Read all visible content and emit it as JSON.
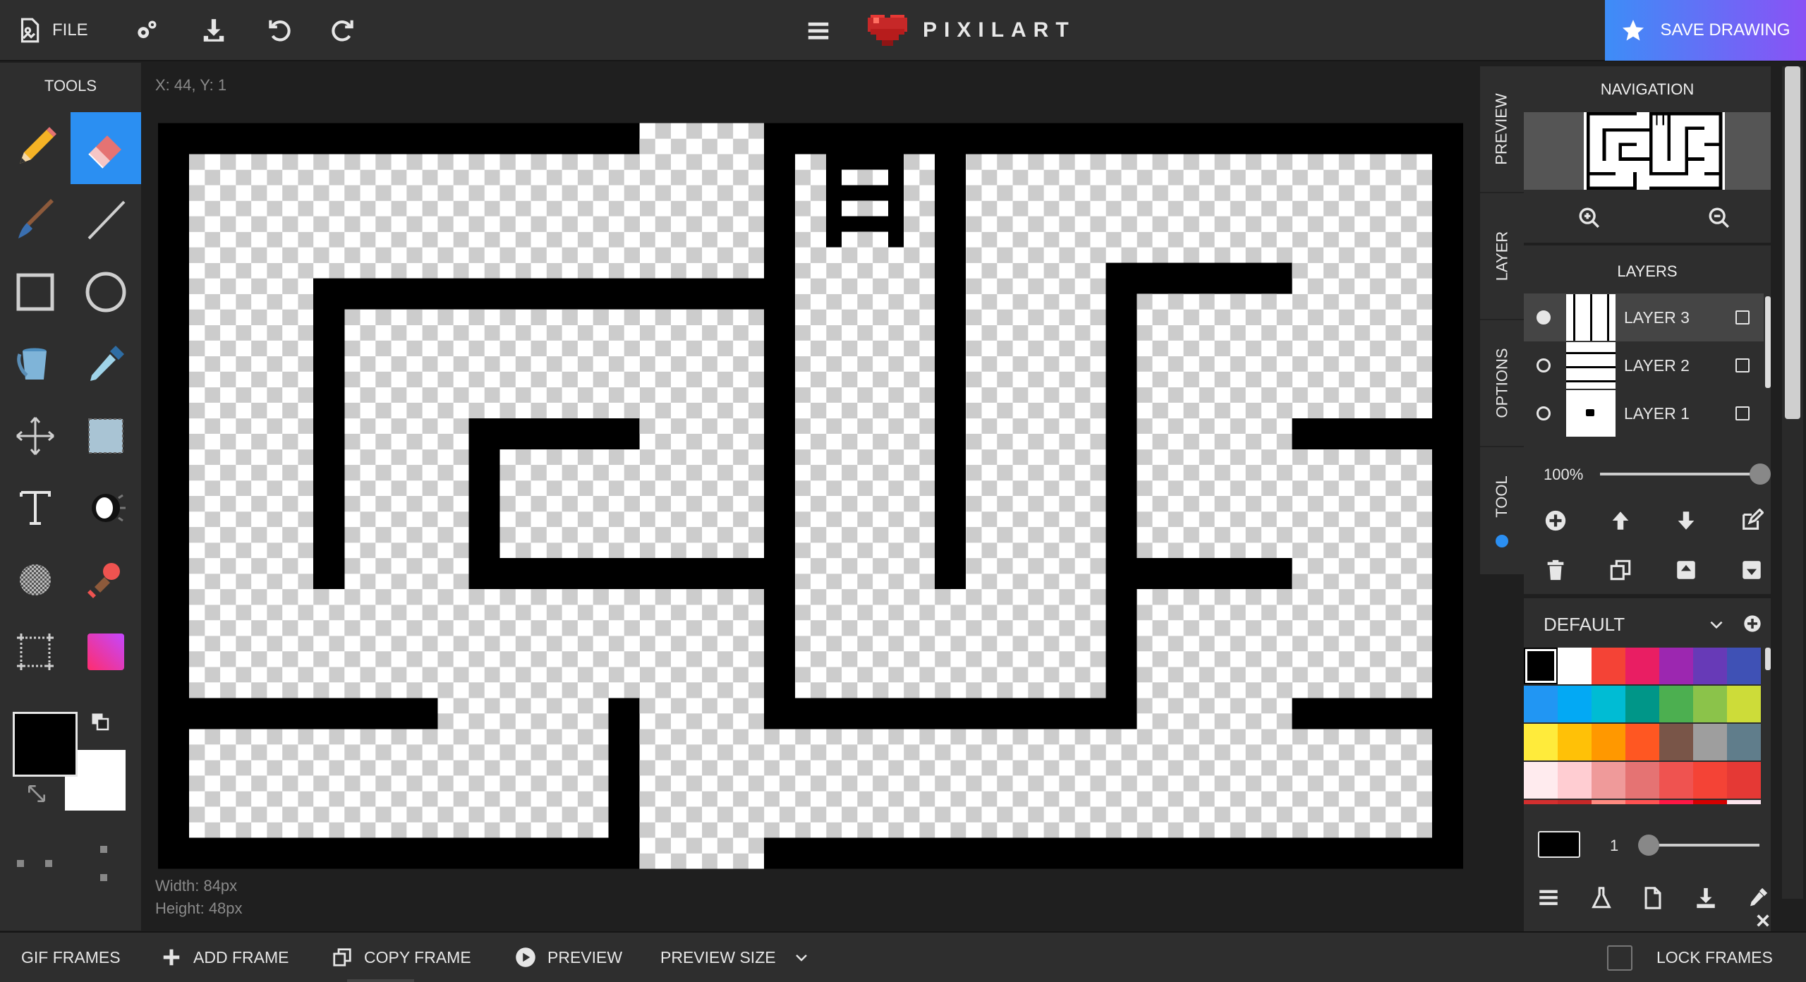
{
  "topbar": {
    "file_label": "FILE",
    "logo_text": "PIXILART",
    "save_label": "SAVE DRAWING"
  },
  "tools": {
    "title": "TOOLS",
    "items": [
      {
        "name": "pencil-tool"
      },
      {
        "name": "eraser-tool",
        "active": true
      },
      {
        "name": "brush-tool"
      },
      {
        "name": "line-tool"
      },
      {
        "name": "rectangle-tool"
      },
      {
        "name": "circle-tool"
      },
      {
        "name": "bucket-fill-tool"
      },
      {
        "name": "eyedropper-tool"
      },
      {
        "name": "move-tool"
      },
      {
        "name": "selection-tool"
      },
      {
        "name": "text-tool"
      },
      {
        "name": "lighten-tool"
      },
      {
        "name": "dither-tool"
      },
      {
        "name": "stamp-tool"
      },
      {
        "name": "crop-tool"
      },
      {
        "name": "gradient-tool"
      }
    ],
    "primary_color": "#000000",
    "secondary_color": "#ffffff"
  },
  "canvas": {
    "coords": "X: 44, Y: 1",
    "width_label": "Width: 84px",
    "height_label": "Height: 48px"
  },
  "side_tabs": [
    "PREVIEW",
    "LAYER",
    "OPTIONS",
    "TOOL"
  ],
  "navigation": {
    "title": "NAVIGATION"
  },
  "layers": {
    "title": "LAYERS",
    "items": [
      {
        "name": "LAYER 3",
        "selected": true
      },
      {
        "name": "LAYER 2",
        "selected": false
      },
      {
        "name": "LAYER 1",
        "selected": false
      }
    ],
    "opacity": "100%"
  },
  "palette": {
    "name": "DEFAULT",
    "brush_size": "1",
    "colors": [
      "#000000",
      "#ffffff",
      "#f44336",
      "#e91e63",
      "#9c27b0",
      "#673ab7",
      "#3f51b5",
      "#2196f3",
      "#03a9f4",
      "#00bcd4",
      "#009688",
      "#4caf50",
      "#8bc34a",
      "#cddc39",
      "#ffeb3b",
      "#ffc107",
      "#ff9800",
      "#ff5722",
      "#795548",
      "#9e9e9e",
      "#607d8b",
      "#ffebee",
      "#ffcdd2",
      "#ef9a9a",
      "#e57373",
      "#ef5350",
      "#f44336",
      "#e53935",
      "#d32f2f",
      "#c62828",
      "#ff8a80",
      "#ff5252",
      "#ff1744",
      "#d50000",
      "#fce4ec"
    ]
  },
  "bottombar": {
    "gif_frames": "GIF FRAMES",
    "add_frame": "ADD FRAME",
    "copy_frame": "COPY FRAME",
    "preview": "PREVIEW",
    "preview_size": "PREVIEW SIZE",
    "lock_frames": "LOCK FRAMES"
  }
}
